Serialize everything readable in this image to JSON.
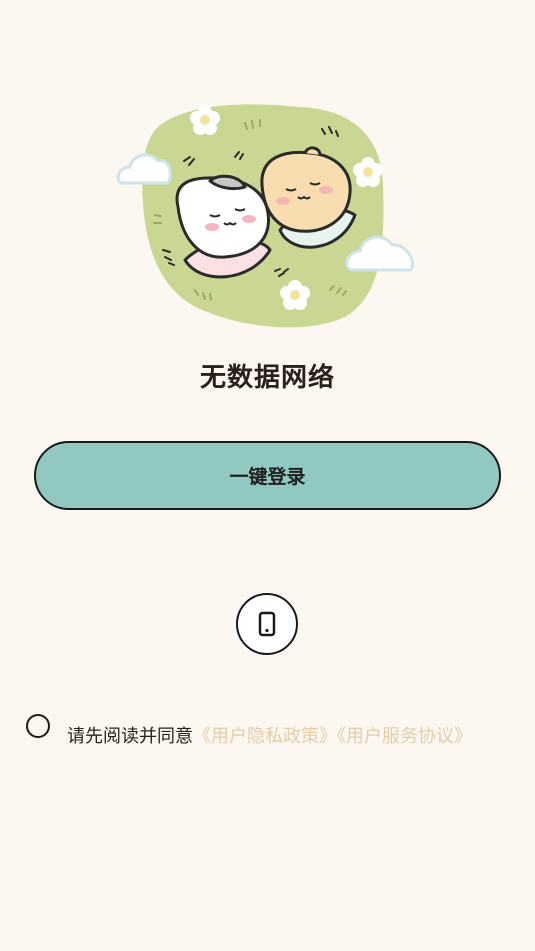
{
  "colors": {
    "background": "#fcf7f0",
    "primary_button": "#91c8c2",
    "link": "#e3ccaa",
    "text": "#2a211d"
  },
  "status": {
    "title": "无数据网络"
  },
  "login": {
    "one_click_label": "一键登录",
    "phone_login_icon": "smartphone-icon"
  },
  "agreement": {
    "checked": false,
    "prefix": "请先阅读并同意",
    "privacy_policy_link": "《用户隐私政策》",
    "service_agreement_link": "《用户服务协议》"
  }
}
